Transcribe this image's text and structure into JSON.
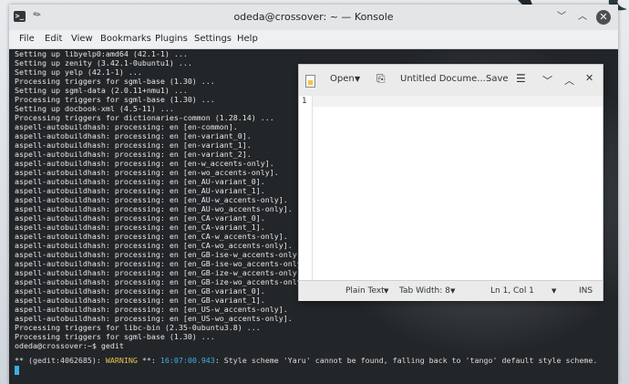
{
  "konsole": {
    "title": "odeda@crossover: ~ — Konsole",
    "menus": [
      "File",
      "Edit",
      "View",
      "Bookmarks",
      "Plugins",
      "Settings",
      "Help"
    ],
    "lines": [
      "Setting up libyelp0:amd64 (42.1-1) ...",
      "Setting up zenity (3.42.1-0ubuntu1) ...",
      "Setting up yelp (42.1-1) ...",
      "Processing triggers for sgml-base (1.30) ...",
      "Setting up sgml-data (2.0.11+nmu1) ...",
      "Processing triggers for sgml-base (1.30) ...",
      "Setting up docbook-xml (4.5-11) ...",
      "Processing triggers for dictionaries-common (1.28.14) ...",
      "aspell-autobuildhash: processing: en [en-common].",
      "aspell-autobuildhash: processing: en [en-variant_0].",
      "aspell-autobuildhash: processing: en [en-variant_1].",
      "aspell-autobuildhash: processing: en [en-variant_2].",
      "aspell-autobuildhash: processing: en [en-w_accents-only].",
      "aspell-autobuildhash: processing: en [en-wo_accents-only].",
      "aspell-autobuildhash: processing: en [en_AU-variant_0].",
      "aspell-autobuildhash: processing: en [en_AU-variant_1].",
      "aspell-autobuildhash: processing: en [en_AU-w_accents-only].",
      "aspell-autobuildhash: processing: en [en_AU-wo_accents-only].",
      "aspell-autobuildhash: processing: en [en_CA-variant_0].",
      "aspell-autobuildhash: processing: en [en_CA-variant_1].",
      "aspell-autobuildhash: processing: en [en_CA-w_accents-only].",
      "aspell-autobuildhash: processing: en [en_CA-wo_accents-only].",
      "aspell-autobuildhash: processing: en [en_GB-ise-w_accents-only].",
      "aspell-autobuildhash: processing: en [en_GB-ise-wo_accents-only].",
      "aspell-autobuildhash: processing: en [en_GB-ize-w_accents-only].",
      "aspell-autobuildhash: processing: en [en_GB-ize-wo_accents-only].",
      "aspell-autobuildhash: processing: en [en_GB-variant_0].",
      "aspell-autobuildhash: processing: en [en_GB-variant_1].",
      "aspell-autobuildhash: processing: en [en_US-w_accents-only].",
      "aspell-autobuildhash: processing: en [en_US-wo_accents-only].",
      "Processing triggers for libc-bin (2.35-0ubuntu3.8) ...",
      "Processing triggers for sgml-base (1.30) ...",
      "odeda@crossover:~$ gedit"
    ],
    "warning": {
      "prefix": "** (gedit:4062685): ",
      "level": "WARNING",
      "sep": " **: ",
      "time": "16:07:00.943",
      "message": ": Style scheme 'Yaru' cannot be found, falling back to 'tango' default style scheme."
    }
  },
  "gedit": {
    "open_label": "Open",
    "doc_title": "Untitled Docume...",
    "save_label": "Save",
    "line_number": "1",
    "status": {
      "language": "Plain Text",
      "tab_width": "Tab Width: 8",
      "position": "Ln 1, Col 1",
      "mode": "INS"
    }
  },
  "icons": {
    "konsole_app": "terminal-icon",
    "pin": "pin-icon",
    "min": "minimize-icon",
    "max": "maximize-icon",
    "close": "close-icon",
    "gedit_doc": "document-icon",
    "new_tab": "new-tab-icon",
    "hamburger": "hamburger-menu-icon"
  },
  "colors": {
    "terminal_bg": "#232629",
    "terminal_fg": "#e6e6e6",
    "warning": "#e8c34d",
    "timestamp": "#3daee9"
  }
}
